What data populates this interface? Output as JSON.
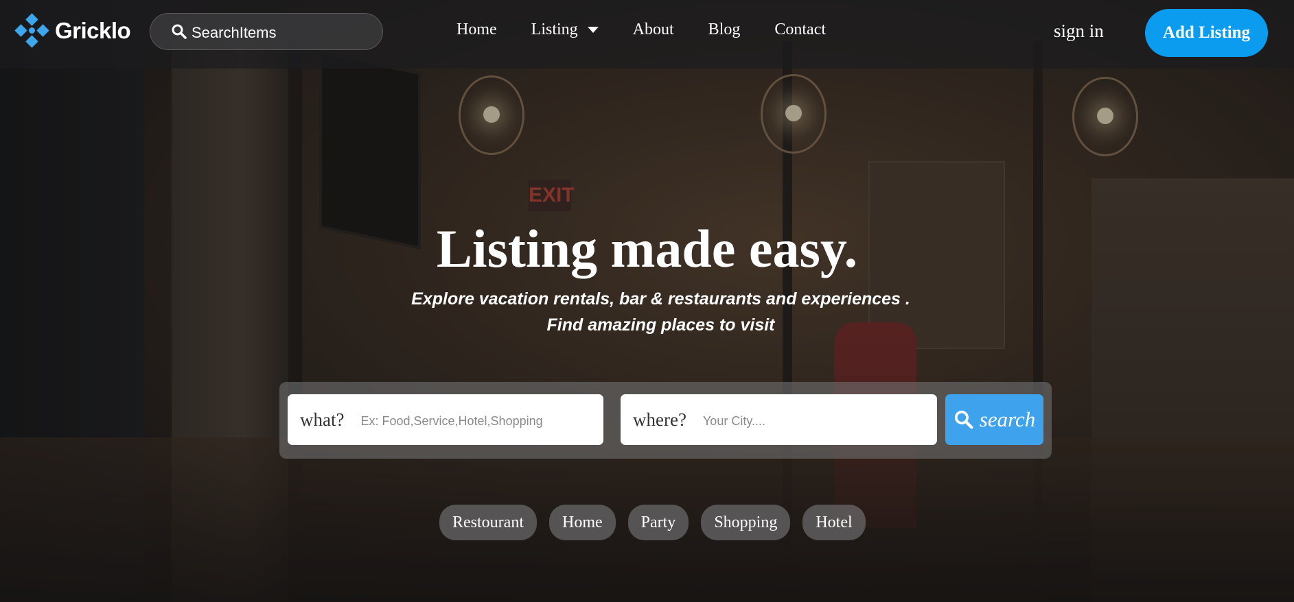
{
  "brand": {
    "name": "Gricklo",
    "accent": "#0b9cf0"
  },
  "header": {
    "search_text": "SearchItems",
    "nav": [
      "Home",
      "Listing",
      "About",
      "Blog",
      "Contact"
    ],
    "sign_in": "sign in",
    "add_listing": "Add Listing"
  },
  "hero": {
    "title": "Listing made easy.",
    "subtitle_line1": "Explore vacation rentals, bar & restaurants and experiences .",
    "subtitle_line2": "Find amazing places to visit"
  },
  "search": {
    "what_label": "what?",
    "what_placeholder": "Ex: Food,Service,Hotel,Shopping",
    "where_label": "where?",
    "where_placeholder": "Your City....",
    "button": "search"
  },
  "categories": [
    "Restourant",
    "Home",
    "Party",
    "Shopping",
    "Hotel"
  ],
  "icons": [
    "logo-mark-icon",
    "search-icon",
    "caret-down-icon"
  ]
}
